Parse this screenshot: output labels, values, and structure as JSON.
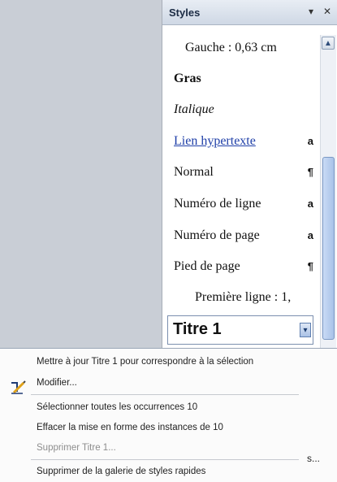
{
  "pane": {
    "title": "Styles",
    "dropdown_glyph": "▾",
    "close_glyph": "✕"
  },
  "styles": [
    {
      "label": "Gauche :  0,63 cm",
      "mark": ""
    },
    {
      "label": "Gras",
      "mark": ""
    },
    {
      "label": "Italique",
      "mark": ""
    },
    {
      "label": "Lien hypertexte",
      "mark": "a"
    },
    {
      "label": "Normal",
      "mark": "¶"
    },
    {
      "label": "Numéro de ligne",
      "mark": "a"
    },
    {
      "label": "Numéro de page",
      "mark": "a"
    },
    {
      "label": "Pied de page",
      "mark": "¶"
    },
    {
      "label": "Première ligne : 1,",
      "mark": ""
    }
  ],
  "selected_style": {
    "label": "Titre 1"
  },
  "context_menu": {
    "items": [
      "Mettre à jour Titre 1 pour correspondre à la sélection",
      "Modifier...",
      "Sélectionner toutes les occurrences 10",
      "Effacer la mise en forme des instances de 10",
      "Supprimer Titre 1...",
      "Supprimer de la galerie de styles rapides"
    ],
    "modify_icon": "edit-style-icon"
  },
  "truncated_text": "s..."
}
